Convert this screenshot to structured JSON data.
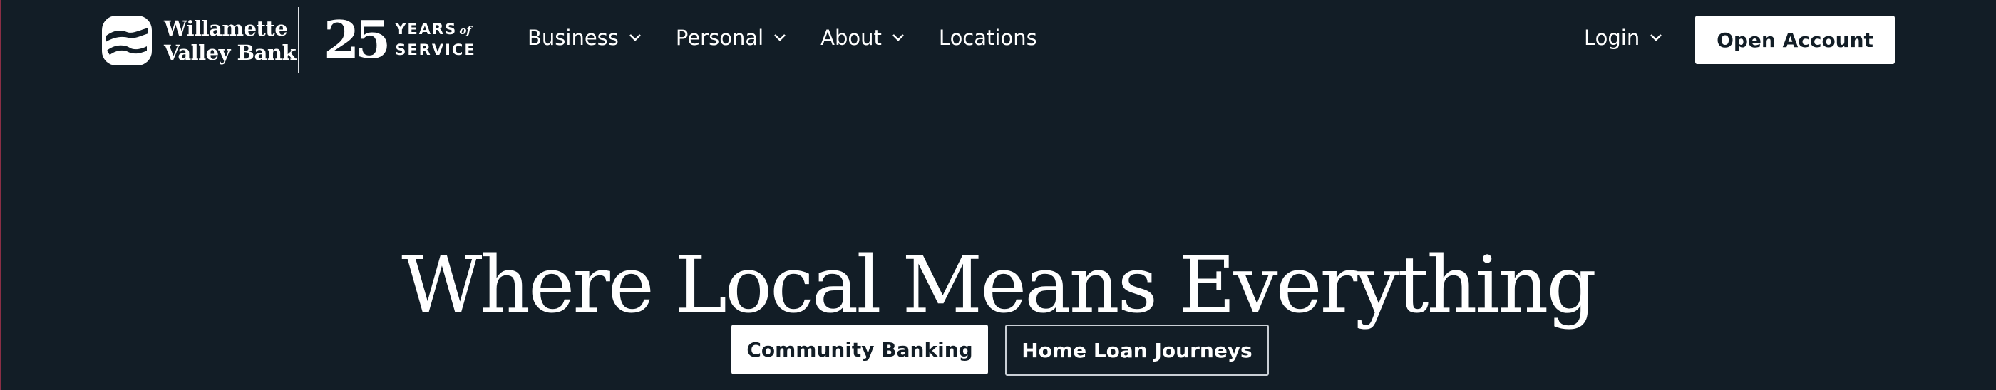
{
  "brand": {
    "name_line1": "Willamette",
    "name_line2": "Valley Bank",
    "anniversary_number": "25",
    "anniversary_line1": "YEARS",
    "anniversary_of": "of",
    "anniversary_line2": "SERVICE",
    "logo_icon": "river-landscape-icon"
  },
  "nav": {
    "items": [
      {
        "label": "Business",
        "has_dropdown": true
      },
      {
        "label": "Personal",
        "has_dropdown": true
      },
      {
        "label": "About",
        "has_dropdown": true
      },
      {
        "label": "Locations",
        "has_dropdown": false
      }
    ],
    "login_label": "Login",
    "open_account_label": "Open Account"
  },
  "hero": {
    "title": "Where Local Means Everything",
    "primary_button": "Community Banking",
    "secondary_button": "Home Loan Journeys"
  },
  "colors": {
    "background": "#121d26",
    "text": "#ffffff",
    "button_background": "#ffffff",
    "button_text": "#121d26",
    "outline_border": "#c9cfd5"
  }
}
